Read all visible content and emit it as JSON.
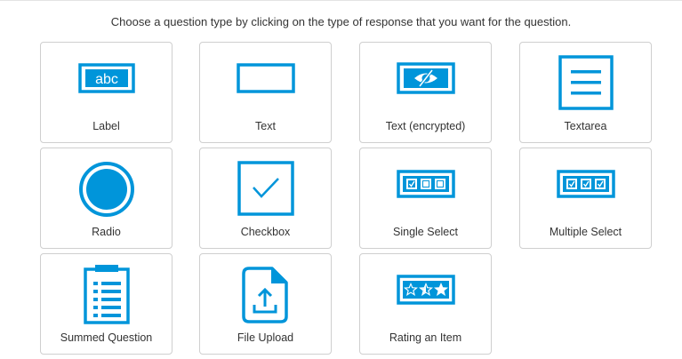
{
  "instruction": "Choose a question type by clicking on the type of response that you want for the question.",
  "accent_color": "#0095da",
  "icon_text_abc": "abc",
  "question_types": [
    {
      "label": "Label",
      "icon": "label-abc-icon"
    },
    {
      "label": "Text",
      "icon": "text-box-icon"
    },
    {
      "label": "Text (encrypted)",
      "icon": "eye-slash-icon"
    },
    {
      "label": "Textarea",
      "icon": "textarea-lines-icon"
    },
    {
      "label": "Radio",
      "icon": "radio-circle-icon"
    },
    {
      "label": "Checkbox",
      "icon": "checkbox-check-icon"
    },
    {
      "label": "Single Select",
      "icon": "single-select-icon"
    },
    {
      "label": "Multiple Select",
      "icon": "multiple-select-icon"
    },
    {
      "label": "Summed Question",
      "icon": "clipboard-list-icon"
    },
    {
      "label": "File Upload",
      "icon": "file-upload-icon"
    },
    {
      "label": "Rating an Item",
      "icon": "star-rating-icon"
    }
  ]
}
